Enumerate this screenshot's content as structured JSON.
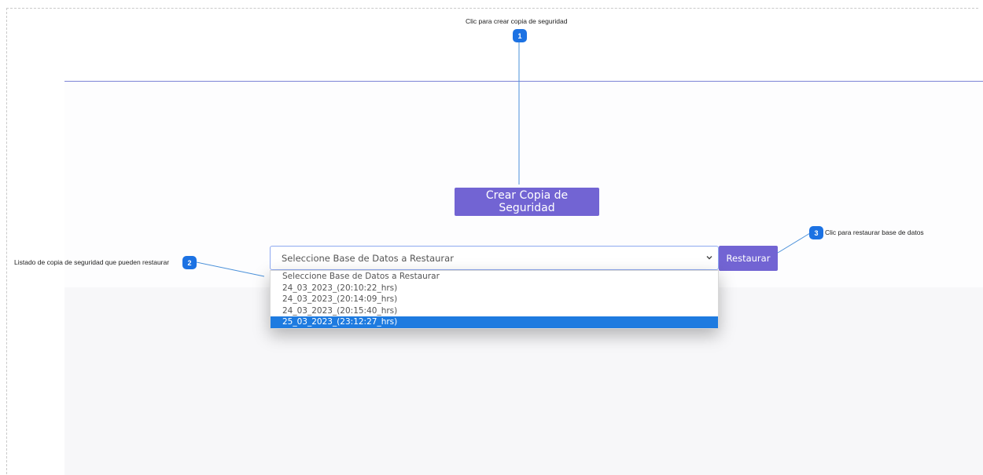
{
  "annotations": {
    "a1": {
      "number": "1",
      "text": "Clic para crear copia de seguridad"
    },
    "a2": {
      "number": "2",
      "text": "Listado de copia de seguridad que pueden restaurar"
    },
    "a3": {
      "number": "3",
      "text": "Clic para restaurar base de datos"
    }
  },
  "backup": {
    "button_label": "Crear Copia de Seguridad"
  },
  "restore": {
    "select_value": "Seleccione Base de Datos a Restaurar",
    "button_label": "Restaurar",
    "options": [
      "Seleccione Base de Datos a Restaurar",
      "24_03_2023_(20:10:22_hrs)",
      "24_03_2023_(20:14:09_hrs)",
      "24_03_2023_(20:15:40_hrs)",
      "25_03_2023_(23:12:27_hrs)"
    ],
    "selected_option": "25_03_2023_(23:12:27_hrs)"
  },
  "colors": {
    "accent": "#7264d3",
    "badge": "#1c72e3",
    "selected_option": "#1e7be0",
    "connector": "#4a90d9"
  },
  "icons": {
    "select_caret": "chevron-down-icon"
  }
}
